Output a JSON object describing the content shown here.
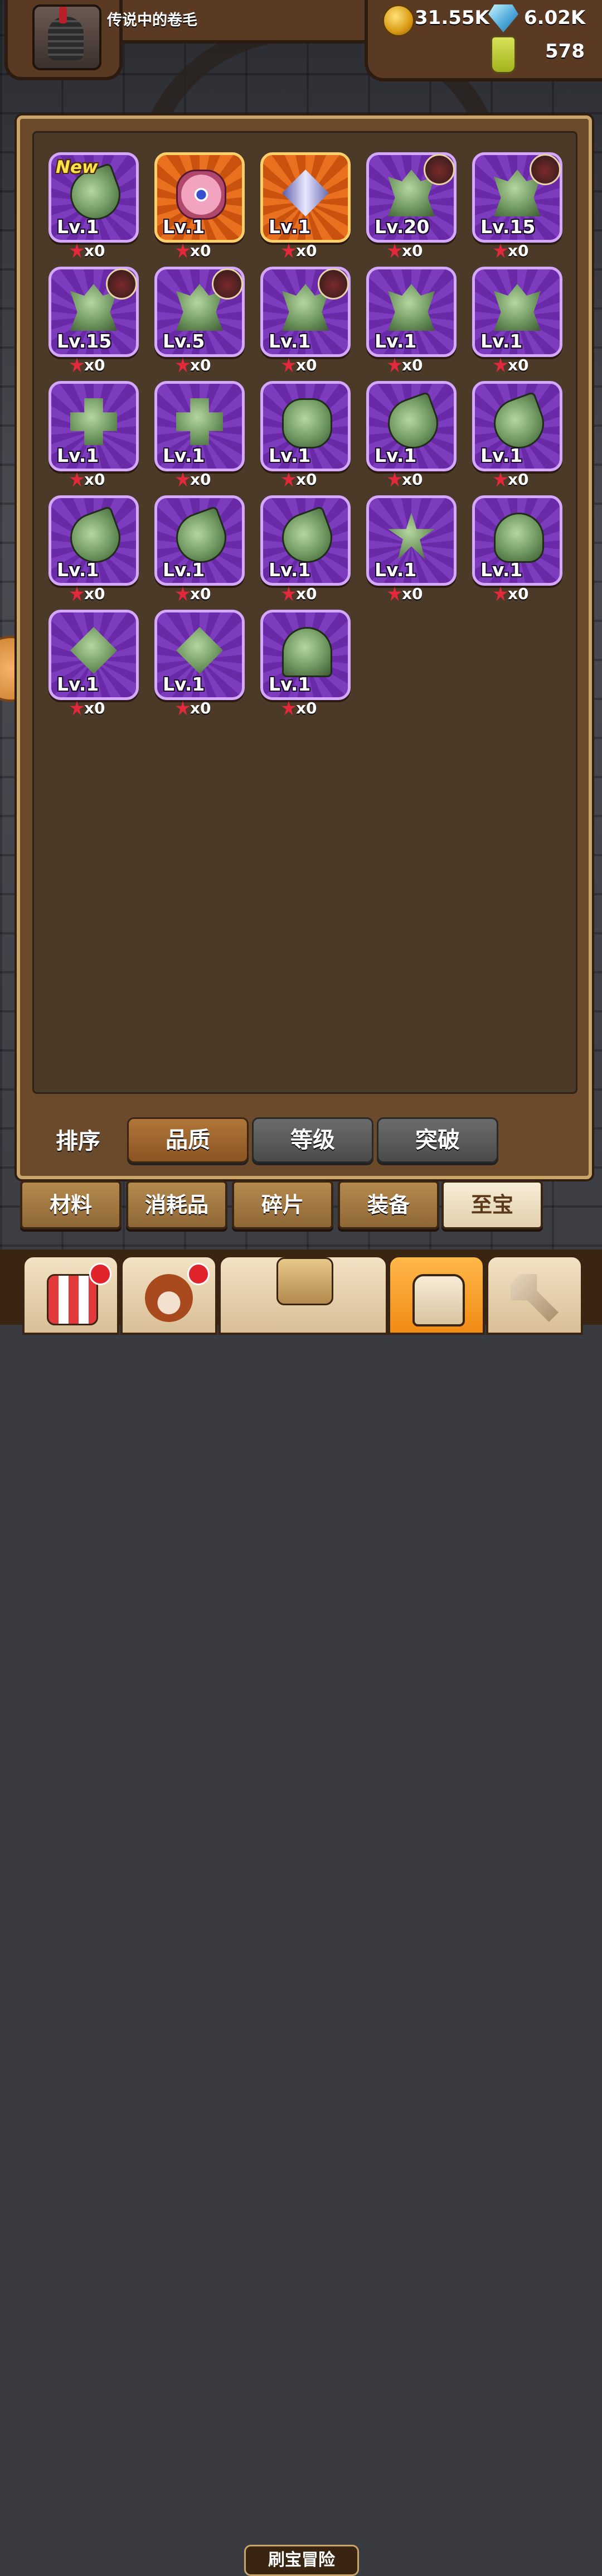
{
  "player": {
    "name": "传说中的卷毛"
  },
  "resources": {
    "gold": "31.55K",
    "gems": "6.02K",
    "potion": "578"
  },
  "items": [
    {
      "level": "Lv.1",
      "count": "x0",
      "is_new": true,
      "icon": "green-flame-icon",
      "frame": "purple"
    },
    {
      "level": "Lv.1",
      "count": "x0",
      "icon": "pink-flower-icon",
      "frame": "orange"
    },
    {
      "level": "Lv.1",
      "count": "x0",
      "icon": "spear-diamond-icon",
      "frame": "orange"
    },
    {
      "level": "Lv.20",
      "count": "x0",
      "icon": "green-crystal-icon",
      "frame": "purple",
      "hero": "hero-portrait-icon"
    },
    {
      "level": "Lv.15",
      "count": "x0",
      "icon": "green-crystal-icon",
      "frame": "purple",
      "hero": "hero-portrait-icon"
    },
    {
      "level": "Lv.15",
      "count": "x0",
      "icon": "green-crystal-icon",
      "frame": "purple",
      "hero": "hero-portrait-icon"
    },
    {
      "level": "Lv.5",
      "count": "x0",
      "icon": "green-crystal-icon",
      "frame": "purple",
      "hero": "hero-portrait-icon"
    },
    {
      "level": "Lv.1",
      "count": "x0",
      "icon": "green-crystal-icon",
      "frame": "purple",
      "hero": "hero-portrait-icon"
    },
    {
      "level": "Lv.1",
      "count": "x0",
      "icon": "green-crystal-icon",
      "frame": "purple"
    },
    {
      "level": "Lv.1",
      "count": "x0",
      "icon": "green-crystal-icon",
      "frame": "purple"
    },
    {
      "level": "Lv.1",
      "count": "x0",
      "icon": "green-cross-icon",
      "frame": "purple"
    },
    {
      "level": "Lv.1",
      "count": "x0",
      "icon": "green-cross-icon",
      "frame": "purple"
    },
    {
      "level": "Lv.1",
      "count": "x0",
      "icon": "green-flower-icon",
      "frame": "purple"
    },
    {
      "level": "Lv.1",
      "count": "x0",
      "icon": "green-flame-icon",
      "frame": "purple"
    },
    {
      "level": "Lv.1",
      "count": "x0",
      "icon": "green-flame-icon",
      "frame": "purple"
    },
    {
      "level": "Lv.1",
      "count": "x0",
      "icon": "green-flame-icon",
      "frame": "purple"
    },
    {
      "level": "Lv.1",
      "count": "x0",
      "icon": "green-flame-icon",
      "frame": "purple"
    },
    {
      "level": "Lv.1",
      "count": "x0",
      "icon": "green-flame-icon",
      "frame": "purple"
    },
    {
      "level": "Lv.1",
      "count": "x0",
      "icon": "green-star-icon",
      "frame": "purple"
    },
    {
      "level": "Lv.1",
      "count": "x0",
      "icon": "green-clover-icon",
      "frame": "purple"
    },
    {
      "level": "Lv.1",
      "count": "x0",
      "icon": "green-diamond-icon",
      "frame": "purple"
    },
    {
      "level": "Lv.1",
      "count": "x0",
      "icon": "green-diamond-icon",
      "frame": "purple"
    },
    {
      "level": "Lv.1",
      "count": "x0",
      "icon": "green-orb-icon",
      "frame": "purple"
    }
  ],
  "new_tag": "New",
  "sort": {
    "label": "排序",
    "options": [
      "品质",
      "等级",
      "突破"
    ],
    "active": 0
  },
  "tabs": {
    "items": [
      "材料",
      "消耗品",
      "碎片",
      "装备",
      "至宝"
    ],
    "active": 4
  },
  "nav": {
    "items": [
      {
        "icon": "shop-icon",
        "badge": true
      },
      {
        "icon": "hero-icon",
        "badge": true
      },
      {
        "icon": "treasure-map-icon",
        "label": "刷宝冒险"
      },
      {
        "icon": "backpack-icon",
        "active": true
      },
      {
        "icon": "hammer-icon"
      }
    ]
  },
  "colors": {
    "accent": "#f08b14",
    "frame_purple": "#7d3bbd",
    "frame_orange": "#e8701e",
    "panel": "#4b3a28"
  }
}
